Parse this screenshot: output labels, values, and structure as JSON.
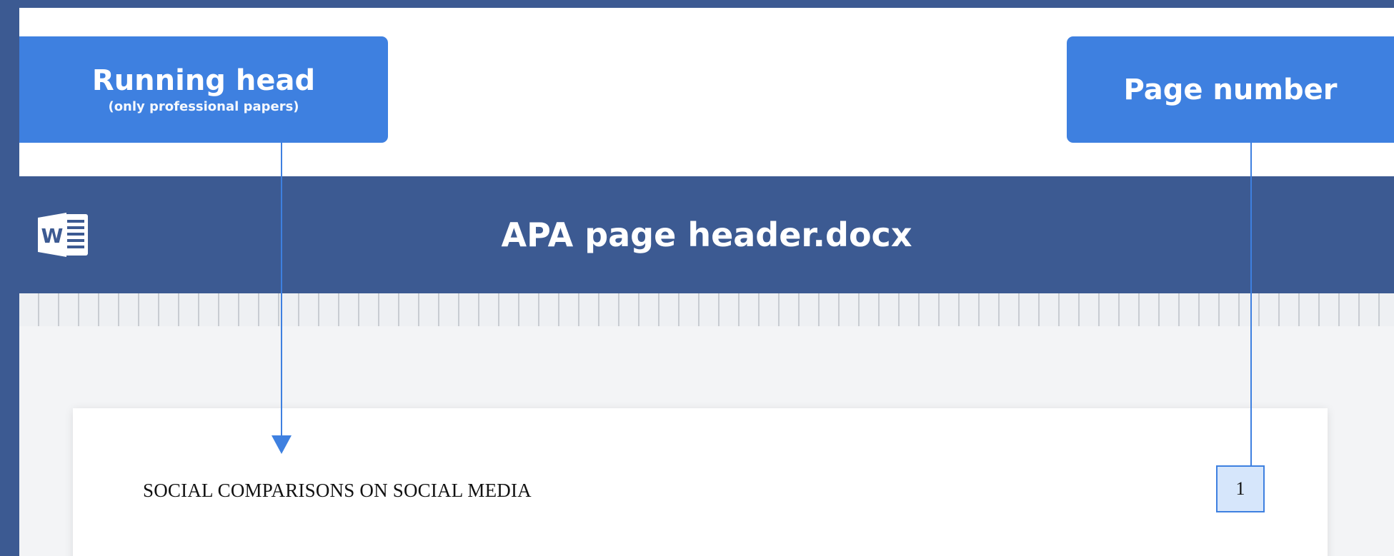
{
  "callouts": {
    "running_head": {
      "title": "Running head",
      "subtitle": "(only professional papers)"
    },
    "page_number": {
      "title": "Page number"
    }
  },
  "app": {
    "title": "APA page header.docx",
    "icon": "word-icon",
    "icon_letter": "W"
  },
  "document": {
    "running_head_text": "SOCIAL COMPARISONS ON SOCIAL MEDIA",
    "page_number": "1"
  },
  "colors": {
    "frame": "#3c5a92",
    "callout": "#3e80e0",
    "page_number_fill": "#d6e6fb"
  }
}
